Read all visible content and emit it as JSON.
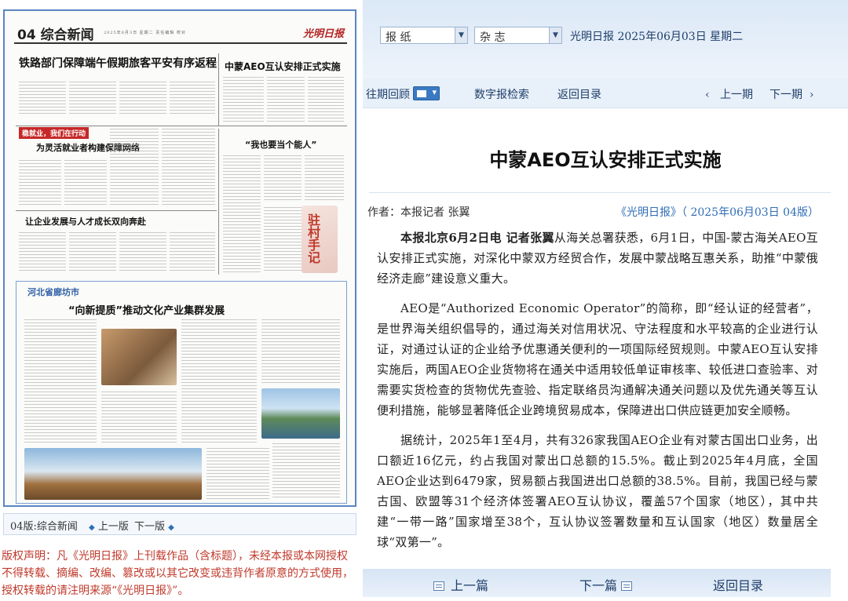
{
  "newspaper_page": {
    "page_label": "04 综合新闻",
    "masthead_logo": "光明日报",
    "meta_line": "2025年6月3日 星期二 责任编辑 校对",
    "headlines": {
      "h1": "铁路部门保障端午假期旅客平安有序返程",
      "h2": "中蒙AEO互认安排正式实施",
      "h3": "为灵活就业者构建保障网络",
      "h4": "“我也要当个能人”",
      "h5": "让企业发展与人才成长双向奔赴",
      "h6": "“向新提质”推动文化产业集群发展"
    },
    "column_tag": "稳就业，我们在行动",
    "bottom_city": "河北省廊坊市",
    "art_badge": "驻村手记"
  },
  "page_nav": {
    "label": "04版:综合新闻",
    "prev": "上一版",
    "next": "下一版"
  },
  "copyright": "版权声明：凡《光明日报》上刊载作品（含标题），未经本报或本网授权不得转载、摘编、改编、篡改或以其它改变或违背作者原意的方式使用，授权转载的请注明来源“《光明日报》”。",
  "top_bar": {
    "select_newspaper": "报  纸",
    "select_magazine": "杂  志",
    "date_text": "光明日报  2025年06月03日  星期二"
  },
  "nav_bar": {
    "history": "往期回顾",
    "search": "数字报检索",
    "back": "返回目录",
    "prev_issue": "上一期",
    "next_issue": "下一期"
  },
  "article": {
    "title": "中蒙AEO互认安排正式实施",
    "author": "作者：本报记者 张翼",
    "source": "《光明日报》（ 2025年06月03日   04版）",
    "lead_bold": "本报北京6月2日电  记者张翼",
    "p1": "从海关总署获悉，6月1日，中国-蒙古海关AEO互认安排正式实施，对深化中蒙双方经贸合作，发展中蒙战略互惠关系，助推“中蒙俄经济走廊”建设意义重大。",
    "p2": "AEO是“Authorized  Economic  Operator”的简称，即“经认证的经营者”，是世界海关组织倡导的，通过海关对信用状况、守法程度和水平较高的企业进行认证，对通过认证的企业给予优惠通关便利的一项国际经贸规则。中蒙AEO互认安排实施后，两国AEO企业货物将在通关中适用较低单证审核率、较低进口查验率、对需要实货检查的货物优先查验、指定联络员沟通解决通关问题以及优先通关等互认便利措施，能够显著降低企业跨境贸易成本，保障进出口供应链更加安全顺畅。",
    "p3": "据统计，2025年1至4月，共有326家我国AEO企业有对蒙古国出口业务，出口额近16亿元，约占我国对蒙出口总额的15.5%。截止到2025年4月底，全国AEO企业达到6479家，贸易额占我国进出口总额的38.5%。目前，我国已经与蒙古国、欧盟等31个经济体签署AEO互认协议，覆盖57个国家（地区），其中共建“一带一路”国家增至38个，互认协议签署数量和互认国家（地区）数量居全球“双第一”。"
  },
  "bottom_bar": {
    "prev_article": "上一篇",
    "next_article": "下一篇",
    "back": "返回目录"
  },
  "colors": {
    "frame_blue": "#5a86c2",
    "link_blue": "#2f6db5",
    "copyright_red": "#c0392b"
  }
}
